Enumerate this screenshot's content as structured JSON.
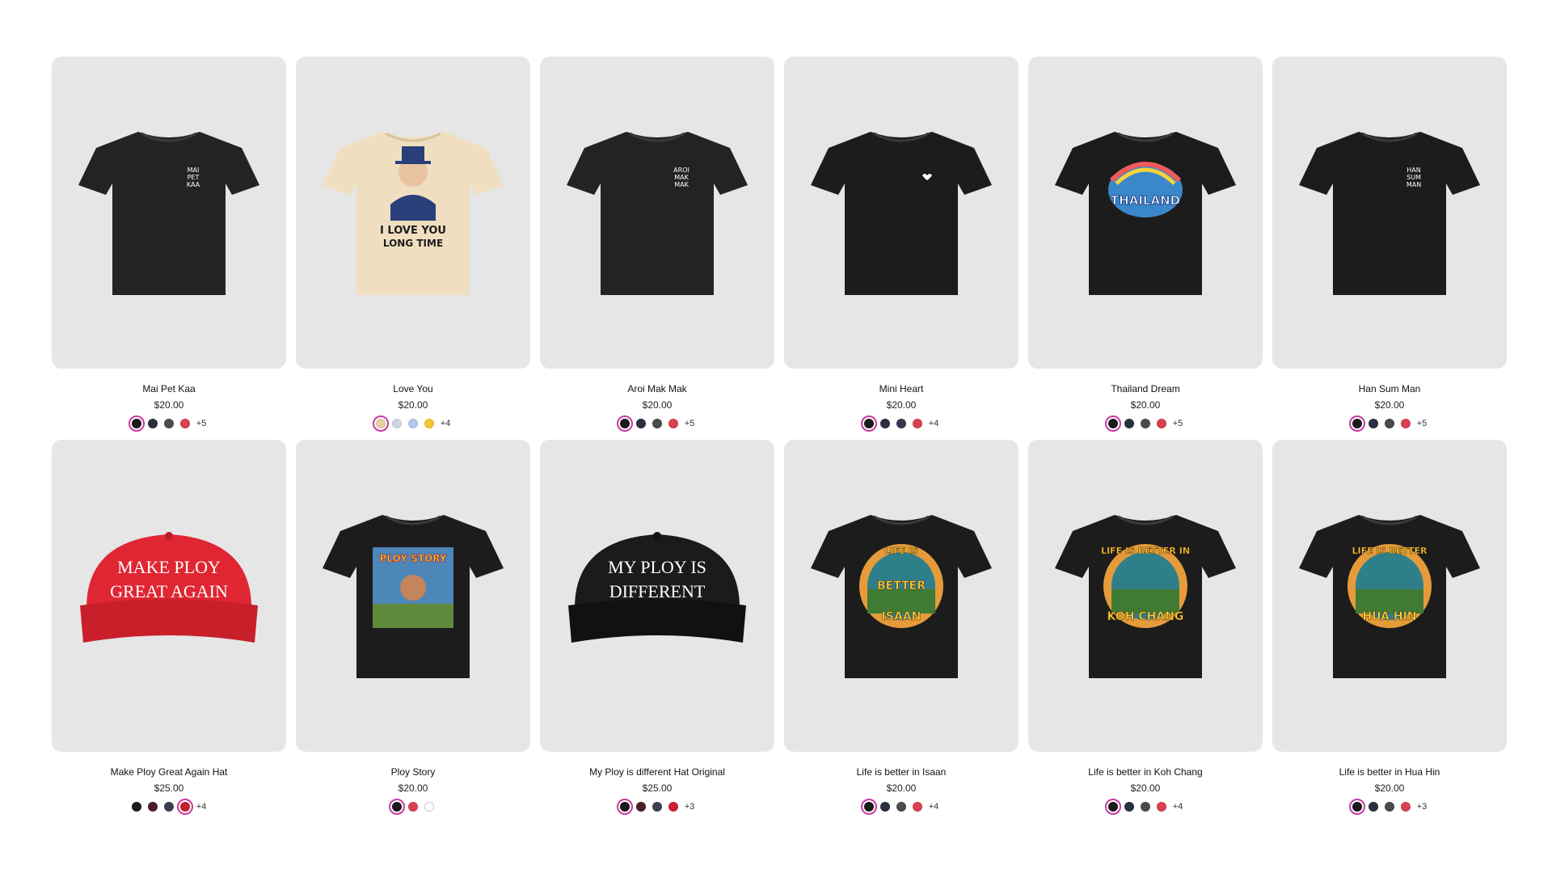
{
  "products": [
    {
      "title": "Mai Pet Kaa",
      "price": "$20.00",
      "type": "tee",
      "shirt_color": "#232323",
      "print": "Mai\nPet\nKaa",
      "print_style": "pocket-text",
      "swatches": [
        "#1b1b1b",
        "#2b3040",
        "#4b4b4b",
        "#d94050"
      ],
      "selected": 0,
      "more": "+5"
    },
    {
      "title": "Love You",
      "price": "$20.00",
      "type": "tee",
      "shirt_color": "#efdfc0",
      "print": "I LOVE YOU LONG TIME",
      "print_style": "poster",
      "swatches": [
        "#e8cfa7",
        "#cfd6e2",
        "#b3c8ea",
        "#f4c52d"
      ],
      "selected": 0,
      "more": "+4"
    },
    {
      "title": "Aroi Mak Mak",
      "price": "$20.00",
      "type": "tee",
      "shirt_color": "#232323",
      "print": "Aroi\nMak\nMak",
      "print_style": "pocket-text",
      "swatches": [
        "#1b1b1b",
        "#2b3040",
        "#4b4b4b",
        "#d94050"
      ],
      "selected": 0,
      "more": "+5"
    },
    {
      "title": "Mini Heart",
      "price": "$20.00",
      "type": "tee",
      "shirt_color": "#1c1c1c",
      "print": "",
      "print_style": "mini-heart",
      "swatches": [
        "#1b1b1b",
        "#2b3040",
        "#353a4e",
        "#d94050"
      ],
      "selected": 0,
      "more": "+4"
    },
    {
      "title": "Thailand Dream",
      "price": "$20.00",
      "type": "tee",
      "shirt_color": "#1c1c1c",
      "print": "THAILAND",
      "print_style": "badge",
      "swatches": [
        "#1b1b1b",
        "#2b3040",
        "#4b4b4b",
        "#d94050"
      ],
      "selected": 0,
      "more": "+5"
    },
    {
      "title": "Han Sum Man",
      "price": "$20.00",
      "type": "tee",
      "shirt_color": "#1c1c1c",
      "print": "Han\nSum\nMan",
      "print_style": "pocket-text",
      "swatches": [
        "#1b1b1b",
        "#2b3040",
        "#4b4b4b",
        "#d94050"
      ],
      "selected": 0,
      "more": "+5"
    },
    {
      "title": "Make Ploy Great Again Hat",
      "price": "$25.00",
      "type": "hat",
      "shirt_color": "#e02633",
      "print": "MAKE PLOY\nGREAT AGAIN",
      "print_style": "hat",
      "swatches": [
        "#1b1b1b",
        "#4a1e2a",
        "#3b3f52",
        "#c4212f"
      ],
      "selected": 3,
      "more": "+4"
    },
    {
      "title": "Ploy Story",
      "price": "$20.00",
      "type": "tee",
      "shirt_color": "#1c1c1c",
      "print": "PLOY STORY",
      "print_style": "square-art",
      "swatches": [
        "#1b1b1b",
        "#d94050",
        "#ffffff"
      ],
      "selected": 0,
      "more": ""
    },
    {
      "title": "My Ploy is different Hat Original",
      "price": "$25.00",
      "type": "hat",
      "shirt_color": "#1b1b1b",
      "print": "MY PLOY IS\nDIFFERENT",
      "print_style": "hat",
      "swatches": [
        "#1b1b1b",
        "#4a1e2a",
        "#3b3f52",
        "#d01f2c"
      ],
      "selected": 0,
      "more": "+3"
    },
    {
      "title": "Life is better in Isaan",
      "price": "$20.00",
      "type": "tee",
      "shirt_color": "#1c1c1c",
      "print": "LIFE IS\nBETTER\nISAAN",
      "print_style": "round-badge",
      "swatches": [
        "#1b1b1b",
        "#2b3040",
        "#4b4b4b",
        "#d94050"
      ],
      "selected": 0,
      "more": "+4"
    },
    {
      "title": "Life is better in Koh Chang",
      "price": "$20.00",
      "type": "tee",
      "shirt_color": "#1c1c1c",
      "print": "LIFE IS BETTER IN\nKOH CHANG",
      "print_style": "round-badge",
      "swatches": [
        "#1b1b1b",
        "#2b3040",
        "#4b4b4b",
        "#d94050"
      ],
      "selected": 0,
      "more": "+4"
    },
    {
      "title": "Life is better in Hua Hin",
      "price": "$20.00",
      "type": "tee",
      "shirt_color": "#1c1c1c",
      "print": "LIFE IS BETTER\nHUA HIN",
      "print_style": "round-badge",
      "swatches": [
        "#1b1b1b",
        "#2b3040",
        "#4b4b4b",
        "#d94050"
      ],
      "selected": 0,
      "more": "+3"
    }
  ]
}
